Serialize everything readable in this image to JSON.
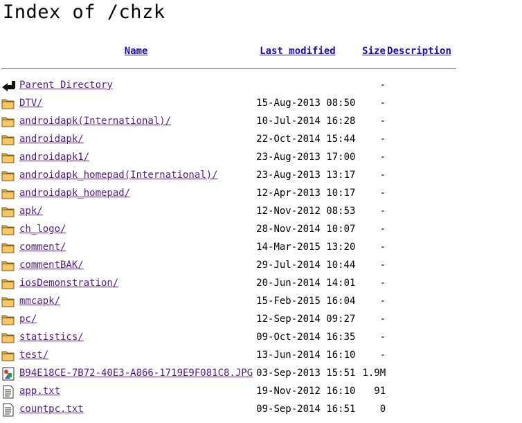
{
  "page": {
    "title": "Index of /chzk"
  },
  "columns": {
    "name": "Name",
    "last_modified": "Last modified",
    "size": "Size",
    "description": "Description"
  },
  "rows": [
    {
      "icon": "back-icon",
      "name": "Parent Directory",
      "modified": "",
      "size": "-"
    },
    {
      "icon": "folder-icon",
      "name": "DTV/",
      "modified": "15-Aug-2013 08:50",
      "size": "-"
    },
    {
      "icon": "folder-icon",
      "name": "androidapk(International)/",
      "modified": "10-Jul-2014 16:28",
      "size": "-"
    },
    {
      "icon": "folder-icon",
      "name": "androidapk/",
      "modified": "22-Oct-2014 15:44",
      "size": "-"
    },
    {
      "icon": "folder-icon",
      "name": "androidapk1/",
      "modified": "23-Aug-2013 17:00",
      "size": "-"
    },
    {
      "icon": "folder-icon",
      "name": "androidapk_homepad(International)/",
      "modified": "23-Aug-2013 13:17",
      "size": "-"
    },
    {
      "icon": "folder-icon",
      "name": "androidapk_homepad/",
      "modified": "12-Apr-2013 10:17",
      "size": "-"
    },
    {
      "icon": "folder-icon",
      "name": "apk/",
      "modified": "12-Nov-2012 08:53",
      "size": "-"
    },
    {
      "icon": "folder-icon",
      "name": "ch_logo/",
      "modified": "28-Nov-2014 10:07",
      "size": "-"
    },
    {
      "icon": "folder-icon",
      "name": "comment/",
      "modified": "14-Mar-2015 13:20",
      "size": "-"
    },
    {
      "icon": "folder-icon",
      "name": "commentBAK/",
      "modified": "29-Jul-2014 10:44",
      "size": "-"
    },
    {
      "icon": "folder-icon",
      "name": "iosDemonstration/",
      "modified": "20-Jun-2014 14:01",
      "size": "-"
    },
    {
      "icon": "folder-icon",
      "name": "mmcapk/",
      "modified": "15-Feb-2015 16:04",
      "size": "-"
    },
    {
      "icon": "folder-icon",
      "name": "pc/",
      "modified": "12-Sep-2014 09:27",
      "size": "-"
    },
    {
      "icon": "folder-icon",
      "name": "statistics/",
      "modified": "09-Oct-2014 16:35",
      "size": "-"
    },
    {
      "icon": "folder-icon",
      "name": "test/",
      "modified": "13-Jun-2014 16:10",
      "size": "-"
    },
    {
      "icon": "image-icon",
      "name": "B94E18CE-7B72-40E3-A866-1719E9F081C8.JPG",
      "modified": "03-Sep-2013 15:51",
      "size": "1.9M"
    },
    {
      "icon": "text-file-icon",
      "name": "app.txt",
      "modified": "19-Nov-2012 16:10",
      "size": "91"
    },
    {
      "icon": "text-file-icon",
      "name": "countpc.txt",
      "modified": "09-Sep-2014 16:51",
      "size": "0"
    }
  ]
}
